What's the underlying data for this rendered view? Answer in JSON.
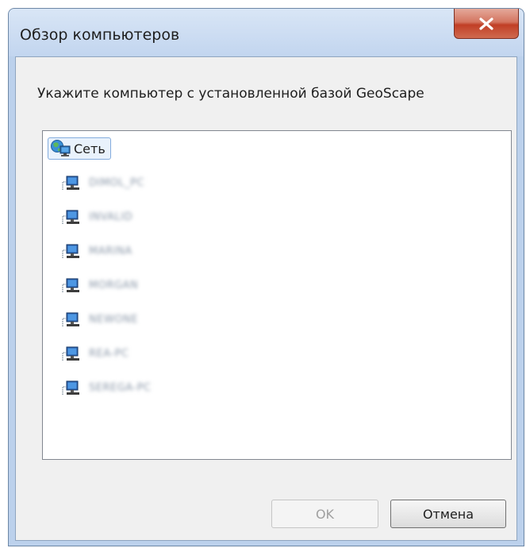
{
  "window": {
    "title": "Обзор компьютеров"
  },
  "dialog": {
    "prompt": "Укажите компьютер с установленной базой GeoScape",
    "tree": {
      "root_label": "Сеть",
      "root_icon": "network-icon",
      "node_icon": "computer-icon",
      "nodes": [
        {
          "label": "DIMOL_PC"
        },
        {
          "label": "INVALID"
        },
        {
          "label": "MARINA"
        },
        {
          "label": "MORGAN"
        },
        {
          "label": "NEWONE"
        },
        {
          "label": "REA-PC"
        },
        {
          "label": "SEREGA-PC"
        }
      ]
    }
  },
  "buttons": {
    "ok_label": "OK",
    "cancel_label": "Отмена"
  }
}
